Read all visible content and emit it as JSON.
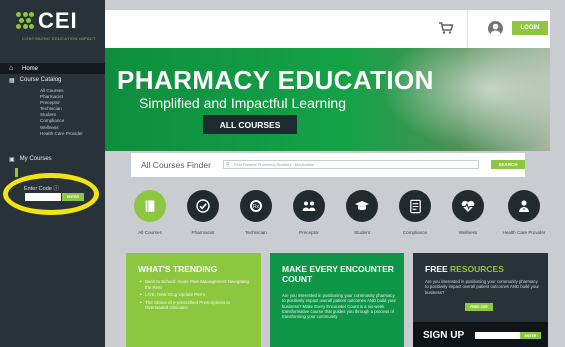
{
  "brand": {
    "logo_text": "CEI",
    "tagline": "CONTINUING EDUCATION IMPACT",
    "accent_color": "#8dc63f"
  },
  "sidebar": {
    "home_label": "Home",
    "catalog_label": "Course Catalog",
    "catalog_items": [
      "All Courses",
      "Pharmacist",
      "Preceptor",
      "Technician",
      "Student",
      "Compliance",
      "Wellness",
      "Health Care Provider"
    ],
    "my_courses_label": "My Courses",
    "enter_code_label": "Enter Code",
    "enter_button": "ENTER"
  },
  "topbar": {
    "cart_icon": "shopping-cart-icon",
    "user_icon": "user-avatar-icon",
    "login_label": "LOGIN"
  },
  "hero": {
    "title": "PHARMACY EDUCATION",
    "subtitle": "Simplified and Impactful Learning",
    "button_label": "ALL COURSES"
  },
  "finder": {
    "label": "All Courses Finder",
    "placeholder": "Find Federal Pharmacy Statutes - Medication",
    "button_label": "SEARCH"
  },
  "categories": [
    {
      "label": "All Courses",
      "icon": "book-icon"
    },
    {
      "label": "Pharmacist",
      "icon": "check-badge-icon"
    },
    {
      "label": "Technician",
      "icon": "rx-seal-icon"
    },
    {
      "label": "Preceptor",
      "icon": "group-icon"
    },
    {
      "label": "Student",
      "icon": "graduation-cap-icon"
    },
    {
      "label": "Compliance",
      "icon": "checklist-icon"
    },
    {
      "label": "Wellness",
      "icon": "heartbeat-icon"
    },
    {
      "label": "Health Care Provider",
      "icon": "doctor-icon"
    }
  ],
  "trending": {
    "title": "WHAT'S TRENDING",
    "items": [
      "Back to School: Acute Pain Management Navigating the Rest",
      "LIVE: New Drug Update Perm",
      "The Status of e-prescribed Prescriptions in Overloaded clinicians"
    ]
  },
  "encounter": {
    "title": "MAKE EVERY ENCOUNTER COUNT",
    "body": "Are you interested in positioning your community pharmacy to positively impact overall patient outcomes AND build your business? Make Every Encounter Count is a six-week transformative course that guides you through a process of transforming your community"
  },
  "resources": {
    "title_part1": "FREE",
    "title_part2": "RESOURCES",
    "body": "Are you interested in positioning your community pharmacy to positively impact overall patient outcomes AND build your business?",
    "button_label": "FREE CEE",
    "signup_title": "SIGN UP",
    "signup_button": "ENTER"
  }
}
